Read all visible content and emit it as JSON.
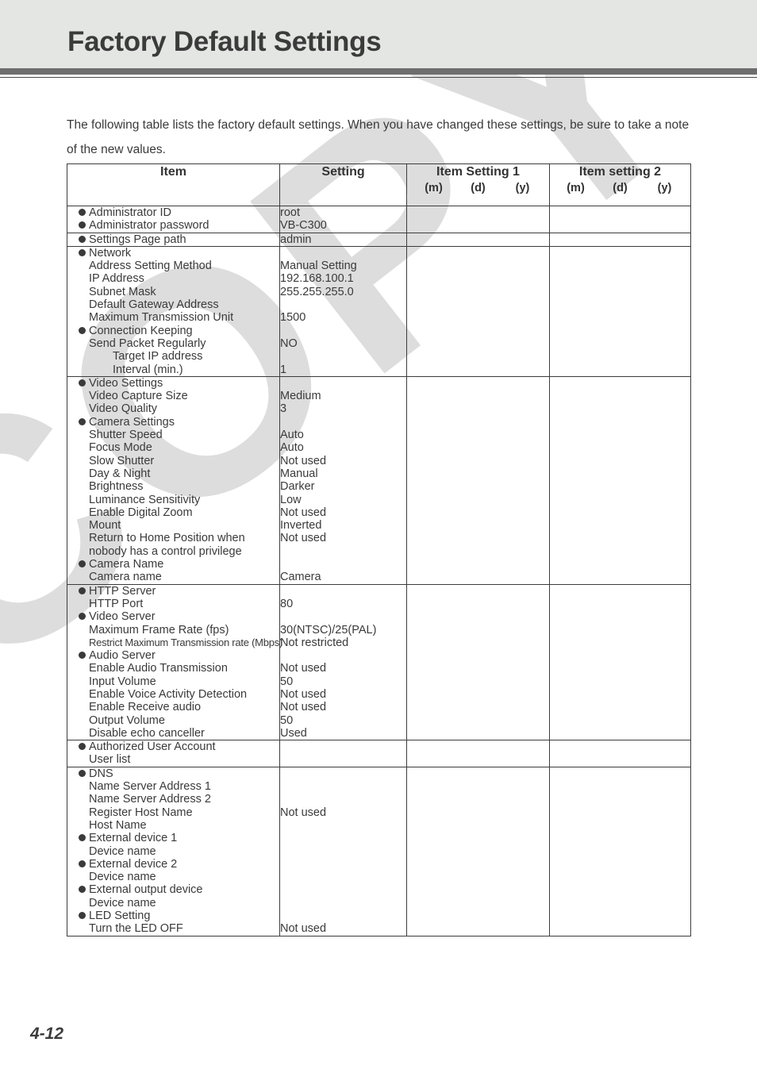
{
  "document": {
    "title": "Factory Default Settings",
    "intro": "The following table lists the factory default settings. When you have changed these settings, be sure to take a note of the new values.",
    "page_number": "4-12",
    "watermark": "COPY",
    "colors": {
      "header_band": "#e4e6e4",
      "header_bar": "#6e6e6e",
      "table_header_fill": "#e8eae8",
      "text": "#3a3a3a",
      "watermark": "#dddddd"
    }
  },
  "table": {
    "headers": {
      "item": "Item",
      "setting": "Setting",
      "item_setting_1": "Item Setting 1",
      "item_setting_2": "Item setting 2",
      "mdy": {
        "m": "(m)",
        "d": "(d)",
        "y": "(y)"
      }
    },
    "sections": [
      {
        "id": "administrator",
        "items": [
          {
            "text": "Administrator ID",
            "level": "bullet"
          },
          {
            "text": "Administrator password",
            "level": "bullet"
          }
        ],
        "values": [
          "root",
          "VB-C300"
        ]
      },
      {
        "id": "settings-page-path",
        "items": [
          {
            "text": "Settings Page path",
            "level": "bullet"
          }
        ],
        "values": [
          "admin"
        ]
      },
      {
        "id": "network",
        "items": [
          {
            "text": "Network",
            "level": "bullet"
          },
          {
            "text": "Address Setting Method",
            "level": "1"
          },
          {
            "text": "IP Address",
            "level": "1"
          },
          {
            "text": "Subnet Mask",
            "level": "1"
          },
          {
            "text": "Default Gateway Address",
            "level": "1"
          },
          {
            "text": "Maximum Transmission Unit",
            "level": "1"
          },
          {
            "text": "Connection Keeping",
            "level": "bullet"
          },
          {
            "text": "Send Packet Regularly",
            "level": "1"
          },
          {
            "text": "Target IP address",
            "level": "2"
          },
          {
            "text": "Interval (min.)",
            "level": "2"
          }
        ],
        "values": [
          "",
          "Manual Setting",
          "192.168.100.1",
          "255.255.255.0",
          "",
          "1500",
          "",
          "NO",
          "",
          "1"
        ]
      },
      {
        "id": "video-camera",
        "items": [
          {
            "text": "Video Settings",
            "level": "bullet"
          },
          {
            "text": "Video Capture Size",
            "level": "1"
          },
          {
            "text": "Video Quality",
            "level": "1"
          },
          {
            "text": "Camera Settings",
            "level": "bullet"
          },
          {
            "text": "Shutter Speed",
            "level": "1"
          },
          {
            "text": "Focus Mode",
            "level": "1"
          },
          {
            "text": "Slow Shutter",
            "level": "1"
          },
          {
            "text": "Day & Night",
            "level": "1"
          },
          {
            "text": "Brightness",
            "level": "1"
          },
          {
            "text": "Luminance Sensitivity",
            "level": "1"
          },
          {
            "text": "Enable Digital Zoom",
            "level": "1"
          },
          {
            "text": "Mount",
            "level": "1"
          },
          {
            "text": "Return to Home Position when",
            "level": "1"
          },
          {
            "text": "nobody has a control privilege",
            "level": "1"
          },
          {
            "text": "Camera Name",
            "level": "bullet"
          },
          {
            "text": "Camera name",
            "level": "1"
          }
        ],
        "values": [
          "",
          "Medium",
          "3",
          "",
          "Auto",
          "Auto",
          "Not used",
          "Manual",
          "Darker",
          "Low",
          "Not used",
          "Inverted",
          "Not used",
          "",
          "",
          "Camera"
        ]
      },
      {
        "id": "servers",
        "items": [
          {
            "text": "HTTP Server",
            "level": "bullet"
          },
          {
            "text": "HTTP Port",
            "level": "1"
          },
          {
            "text": "Video Server",
            "level": "bullet"
          },
          {
            "text": "Maximum Frame Rate (fps)",
            "level": "1"
          },
          {
            "text": "Restrict Maximum Transmission rate (Mbps)",
            "level": "1",
            "small": true
          },
          {
            "text": "Audio Server",
            "level": "bullet"
          },
          {
            "text": "Enable Audio Transmission",
            "level": "1"
          },
          {
            "text": "Input Volume",
            "level": "1"
          },
          {
            "text": "Enable Voice Activity Detection",
            "level": "1"
          },
          {
            "text": "Enable Receive audio",
            "level": "1"
          },
          {
            "text": "Output Volume",
            "level": "1"
          },
          {
            "text": "Disable echo canceller",
            "level": "1"
          }
        ],
        "values": [
          "",
          "80",
          "",
          "30(NTSC)/25(PAL)",
          "Not restricted",
          "",
          "Not used",
          "50",
          "Not used",
          "Not used",
          "50",
          "Used"
        ]
      },
      {
        "id": "authorized-user-account",
        "items": [
          {
            "text": "Authorized User Account",
            "level": "bullet"
          },
          {
            "text": "User list",
            "level": "1"
          }
        ],
        "values": [
          "",
          ""
        ]
      },
      {
        "id": "dns-devices",
        "items": [
          {
            "text": "DNS",
            "level": "bullet"
          },
          {
            "text": "Name Server Address 1",
            "level": "1"
          },
          {
            "text": "Name Server Address 2",
            "level": "1"
          },
          {
            "text": "Register Host Name",
            "level": "1"
          },
          {
            "text": "Host Name",
            "level": "1"
          },
          {
            "text": "External device 1",
            "level": "bullet"
          },
          {
            "text": "Device name",
            "level": "1"
          },
          {
            "text": "External device 2",
            "level": "bullet"
          },
          {
            "text": "Device name",
            "level": "1"
          },
          {
            "text": "External output device",
            "level": "bullet"
          },
          {
            "text": "Device name",
            "level": "1"
          },
          {
            "text": "LED Setting",
            "level": "bullet"
          },
          {
            "text": "Turn the LED OFF",
            "level": "1"
          }
        ],
        "values": [
          "",
          "",
          "",
          "Not used",
          "",
          "",
          "",
          "",
          "",
          "",
          "",
          "",
          "Not used"
        ]
      }
    ]
  }
}
